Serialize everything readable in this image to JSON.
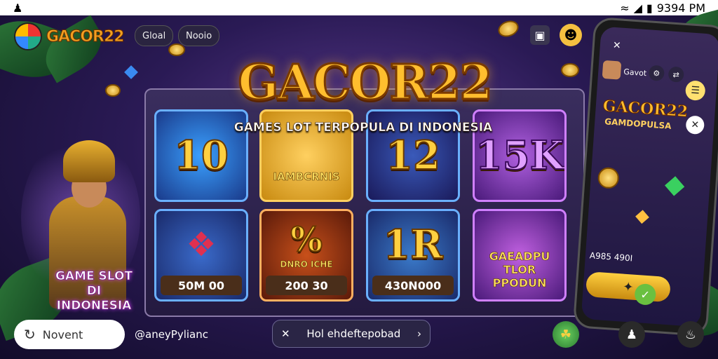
{
  "status_bar": {
    "left_icon": "person-icon",
    "time": "9394 PM"
  },
  "app_bar": {
    "brand": "GACOR22",
    "pill_1": "Gloal",
    "pill_2": "Nooio"
  },
  "hero_banner": {
    "title": "GACOR22",
    "subtitle": "GAMES LOT TERPOPULA DI INDONESIA"
  },
  "tiles": [
    {
      "value": "10",
      "tag": ""
    },
    {
      "label": "IAMBCRNIS",
      "tag": ""
    },
    {
      "value": "12",
      "tag": ""
    },
    {
      "value": "15K",
      "tag": ""
    },
    {
      "tag": "50M 00"
    },
    {
      "value": "%",
      "label": "DNRO ICHE",
      "tag": "200 30"
    },
    {
      "value": "1R",
      "tag": "430N000"
    },
    {
      "label": "GAEADPU",
      "tag": "TLOR PPODUN"
    }
  ],
  "hero_caption": {
    "line1": "GAME SLOT",
    "line2": "DI INDONESIA"
  },
  "phone": {
    "user": "Gavot",
    "title": "GACOR22",
    "subtitle": "GAMDOPULSA",
    "amount": "A985 490I"
  },
  "bottom_bar": {
    "nav_label": "Novent",
    "handle": "@aneyPylianc",
    "promo_text": "Hol ehdeftepobad"
  },
  "colors": {
    "gold": "#ffbe2e",
    "bg_purple": "#2a1a55",
    "accent_green": "#6ac040"
  }
}
